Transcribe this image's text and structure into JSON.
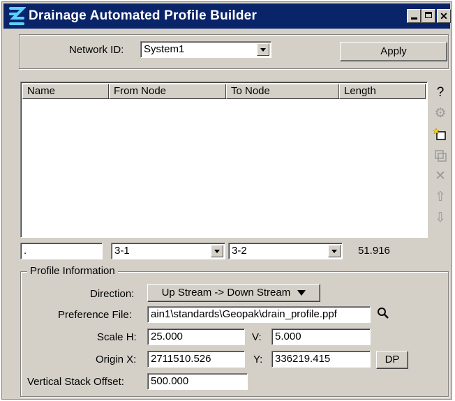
{
  "window": {
    "title": "Drainage Automated Profile Builder"
  },
  "network": {
    "label": "Network ID:",
    "value": "System1",
    "apply_label": "Apply"
  },
  "list": {
    "columns": [
      "Name",
      "From Node",
      "To Node",
      "Length"
    ],
    "rows": []
  },
  "edit_row": {
    "name": ".",
    "from_node": "3-1",
    "to_node": "3-2",
    "length": "51.916"
  },
  "side_icons": [
    "help-icon",
    "link-icon",
    "new-icon",
    "copy-icon",
    "delete-icon",
    "move-up-icon",
    "move-down-icon"
  ],
  "profile": {
    "group_title": "Profile Information",
    "direction_label": "Direction:",
    "direction_value": "Up Stream -> Down Stream",
    "pref_label": "Preference File:",
    "pref_value": "ain1\\standards\\Geopak\\drain_profile.ppf",
    "scale_h_label": "Scale H:",
    "scale_h_value": "25.000",
    "scale_v_label": "V:",
    "scale_v_value": "5.000",
    "origin_x_label": "Origin X:",
    "origin_x_value": "2711510.526",
    "origin_y_label": "Y:",
    "origin_y_value": "336219.415",
    "dp_label": "DP",
    "vso_label": "Vertical Stack Offset:",
    "vso_value": "500.000"
  }
}
